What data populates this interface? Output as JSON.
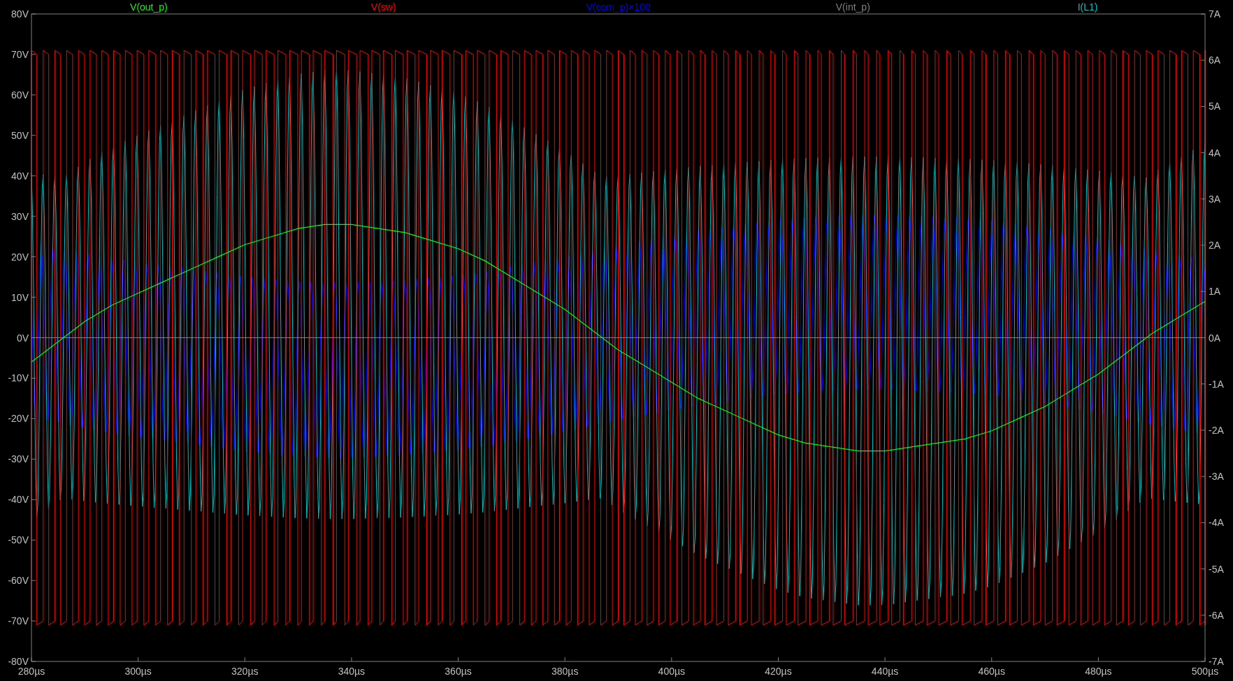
{
  "legend": [
    {
      "name": "V(sw)",
      "color": "#ff0000"
    },
    {
      "name": "V(com_p)×100",
      "color": "#0000ff"
    },
    {
      "name": "I(L1)",
      "color": "#00c0c0"
    }
  ],
  "chart_data": {
    "type": "line",
    "x": [
      280,
      285,
      290,
      295,
      300,
      305,
      310,
      315,
      320,
      325,
      330,
      335,
      340,
      345,
      350,
      355,
      360,
      365,
      370,
      375,
      380,
      385,
      390,
      395,
      400,
      405,
      410,
      415,
      420,
      425,
      430,
      435,
      440,
      445,
      450,
      455,
      460,
      465,
      470,
      475,
      480,
      485,
      490,
      495,
      500
    ],
    "series": [
      {
        "name": "V(out_p)",
        "color": "#00ff00",
        "values": [
          -6,
          -1,
          4,
          8,
          11,
          14,
          17,
          20,
          23,
          25,
          27,
          28,
          28,
          27,
          26,
          24,
          22,
          19,
          15,
          11,
          7,
          2,
          -3,
          -7,
          -11,
          -15,
          -18,
          -21,
          -24,
          -26,
          -27,
          -28,
          -28,
          -27,
          -26,
          -25,
          -23,
          -20,
          -17,
          -13,
          -9,
          -4,
          1,
          5,
          9
        ]
      },
      {
        "name": "V(int_p)",
        "color": "#808080",
        "values": [
          0,
          0,
          0,
          0,
          0,
          0,
          0,
          0,
          0,
          0,
          0,
          0,
          0,
          0,
          0,
          0,
          0,
          0,
          0,
          0,
          0,
          0,
          0,
          0,
          0,
          0,
          0,
          0,
          0,
          0,
          0,
          0,
          0,
          0,
          0,
          0,
          0,
          0,
          0,
          0,
          0,
          0,
          0,
          0,
          0
        ]
      }
    ],
    "xlim": [
      280,
      500
    ],
    "ylim": [
      -80,
      80
    ],
    "y2lim": [
      -7,
      7
    ],
    "xticks": [
      {
        "value": 280,
        "label": "280µs"
      },
      {
        "value": 300,
        "label": "300µs"
      },
      {
        "value": 320,
        "label": "320µs"
      },
      {
        "value": 340,
        "label": "340µs"
      },
      {
        "value": 360,
        "label": "360µs"
      },
      {
        "value": 380,
        "label": "380µs"
      },
      {
        "value": 400,
        "label": "400µs"
      },
      {
        "value": 420,
        "label": "420µs"
      },
      {
        "value": 440,
        "label": "440µs"
      },
      {
        "value": 460,
        "label": "460µs"
      },
      {
        "value": 480,
        "label": "480µs"
      },
      {
        "value": 500,
        "label": "500µs"
      }
    ],
    "yticks": [
      {
        "value": 80,
        "label": "80V"
      },
      {
        "value": 70,
        "label": "70V"
      },
      {
        "value": 60,
        "label": "60V"
      },
      {
        "value": 50,
        "label": "50V"
      },
      {
        "value": 40,
        "label": "40V"
      },
      {
        "value": 30,
        "label": "30V"
      },
      {
        "value": 20,
        "label": "20V"
      },
      {
        "value": 10,
        "label": "10V"
      },
      {
        "value": 0,
        "label": "0V"
      },
      {
        "value": -10,
        "label": "-10V"
      },
      {
        "value": -20,
        "label": "-20V"
      },
      {
        "value": -30,
        "label": "-30V"
      },
      {
        "value": -40,
        "label": "-40V"
      },
      {
        "value": -50,
        "label": "-50V"
      },
      {
        "value": -60,
        "label": "-60V"
      },
      {
        "value": -70,
        "label": "-70V"
      },
      {
        "value": -80,
        "label": "-80V"
      }
    ],
    "y2ticks": [
      {
        "value": 7,
        "label": "7A"
      },
      {
        "value": 6,
        "label": "6A"
      },
      {
        "value": 5,
        "label": "5A"
      },
      {
        "value": 4,
        "label": "4A"
      },
      {
        "value": 3,
        "label": "3A"
      },
      {
        "value": 2,
        "label": "2A"
      },
      {
        "value": 1,
        "label": "1A"
      },
      {
        "value": 0,
        "label": "0A"
      },
      {
        "value": -1,
        "label": "-1A"
      },
      {
        "value": -2,
        "label": "-2A"
      },
      {
        "value": -3,
        "label": "-3A"
      },
      {
        "value": -4,
        "label": "-4A"
      },
      {
        "value": -5,
        "label": "-5A"
      },
      {
        "value": -6,
        "label": "-6A"
      },
      {
        "value": -7,
        "label": "-7A"
      }
    ]
  }
}
